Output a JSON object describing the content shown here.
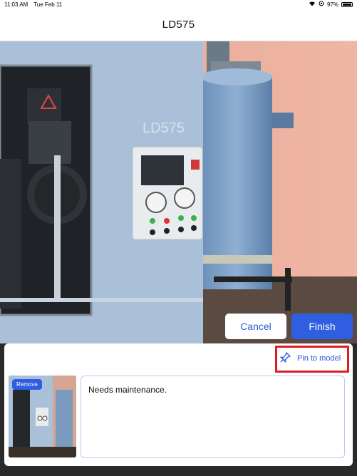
{
  "status": {
    "time": "11:03 AM",
    "date": "Tue Feb 11",
    "battery": "97%",
    "battery_level": 0.97
  },
  "nav": {
    "title": "LD575"
  },
  "scene": {
    "machine_label": "LD575"
  },
  "actions": {
    "cancel_label": "Cancel",
    "finish_label": "Finish"
  },
  "panel": {
    "pin_label": "Pin to model",
    "remove_label": "Remove",
    "note_text": "Needs maintenance."
  }
}
